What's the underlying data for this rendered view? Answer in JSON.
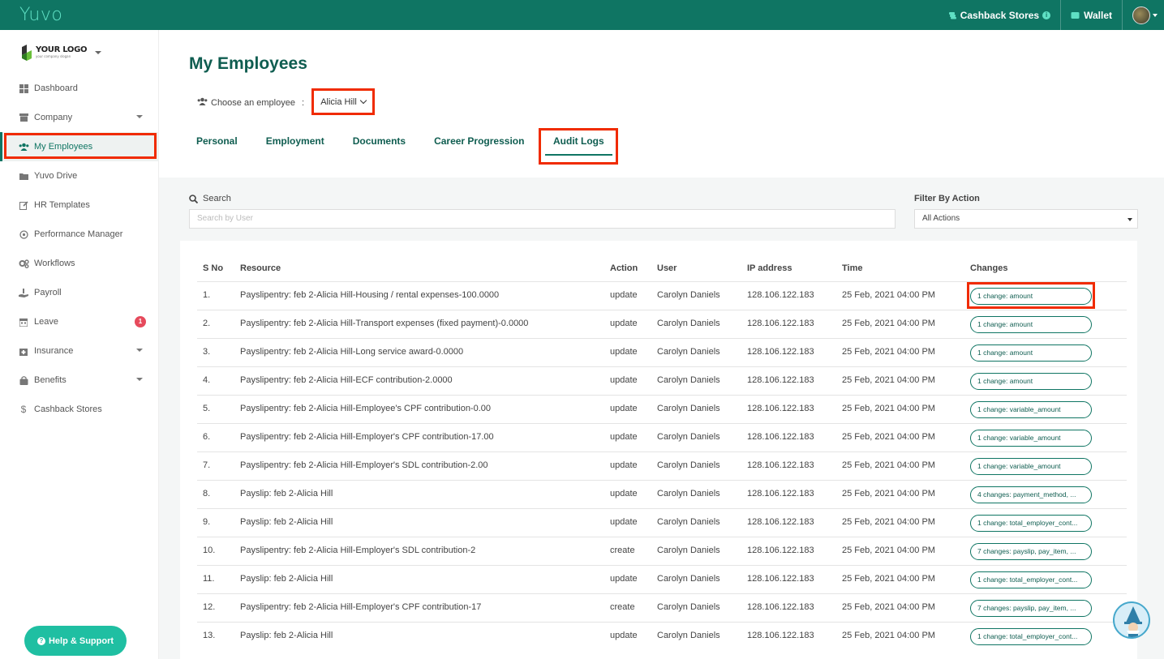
{
  "topbar": {
    "brand": "Yuvo",
    "cashback_label": "Cashback Stores",
    "wallet_label": "Wallet"
  },
  "sidebar": {
    "logo_title": "YOUR LOGO",
    "logo_slogan": "your company slogan",
    "items": [
      {
        "label": "Dashboard",
        "icon": "grid-icon"
      },
      {
        "label": "Company",
        "icon": "archive-icon"
      },
      {
        "label": "My Employees",
        "icon": "users-icon"
      },
      {
        "label": "Yuvo Drive",
        "icon": "folder-icon"
      },
      {
        "label": "HR Templates",
        "icon": "edit-icon"
      },
      {
        "label": "Performance Manager",
        "icon": "target-icon"
      },
      {
        "label": "Workflows",
        "icon": "cogs-icon"
      },
      {
        "label": "Payroll",
        "icon": "hand-coins-icon"
      },
      {
        "label": "Leave",
        "icon": "calendar-icon",
        "badge": "1"
      },
      {
        "label": "Insurance",
        "icon": "medkit-icon"
      },
      {
        "label": "Benefits",
        "icon": "bag-icon"
      },
      {
        "label": "Cashback Stores",
        "icon": "dollar-icon"
      }
    ],
    "help_label": "Help & Support"
  },
  "main": {
    "title": "My Employees",
    "choose_label": "Choose an employee",
    "separator": ":",
    "employee": "Alicia Hill",
    "tabs": [
      "Personal",
      "Employment",
      "Documents",
      "Career Progression",
      "Audit Logs"
    ],
    "search_label": "Search",
    "search_placeholder": "Search by User",
    "filter_label": "Filter By Action",
    "filter_value": "All Actions"
  },
  "table": {
    "headers": [
      "S No",
      "Resource",
      "Action",
      "User",
      "IP address",
      "Time",
      "Changes"
    ],
    "rows": [
      {
        "sno": "1.",
        "resource": "Payslipentry: feb 2-Alicia Hill-Housing / rental expenses-100.0000",
        "action": "update",
        "user": "Carolyn Daniels",
        "ip": "128.106.122.183",
        "time": "25 Feb, 2021 04:00 PM",
        "changes": "1 change: amount"
      },
      {
        "sno": "2.",
        "resource": "Payslipentry: feb 2-Alicia Hill-Transport expenses (fixed payment)-0.0000",
        "action": "update",
        "user": "Carolyn Daniels",
        "ip": "128.106.122.183",
        "time": "25 Feb, 2021 04:00 PM",
        "changes": "1 change: amount"
      },
      {
        "sno": "3.",
        "resource": "Payslipentry: feb 2-Alicia Hill-Long service award-0.0000",
        "action": "update",
        "user": "Carolyn Daniels",
        "ip": "128.106.122.183",
        "time": "25 Feb, 2021 04:00 PM",
        "changes": "1 change: amount"
      },
      {
        "sno": "4.",
        "resource": "Payslipentry: feb 2-Alicia Hill-ECF contribution-2.0000",
        "action": "update",
        "user": "Carolyn Daniels",
        "ip": "128.106.122.183",
        "time": "25 Feb, 2021 04:00 PM",
        "changes": "1 change: amount"
      },
      {
        "sno": "5.",
        "resource": "Payslipentry: feb 2-Alicia Hill-Employee's CPF contribution-0.00",
        "action": "update",
        "user": "Carolyn Daniels",
        "ip": "128.106.122.183",
        "time": "25 Feb, 2021 04:00 PM",
        "changes": "1 change: variable_amount"
      },
      {
        "sno": "6.",
        "resource": "Payslipentry: feb 2-Alicia Hill-Employer's CPF contribution-17.00",
        "action": "update",
        "user": "Carolyn Daniels",
        "ip": "128.106.122.183",
        "time": "25 Feb, 2021 04:00 PM",
        "changes": "1 change: variable_amount"
      },
      {
        "sno": "7.",
        "resource": "Payslipentry: feb 2-Alicia Hill-Employer's SDL contribution-2.00",
        "action": "update",
        "user": "Carolyn Daniels",
        "ip": "128.106.122.183",
        "time": "25 Feb, 2021 04:00 PM",
        "changes": "1 change: variable_amount"
      },
      {
        "sno": "8.",
        "resource": "Payslip: feb 2-Alicia Hill",
        "action": "update",
        "user": "Carolyn Daniels",
        "ip": "128.106.122.183",
        "time": "25 Feb, 2021 04:00 PM",
        "changes": "4 changes: payment_method, ..."
      },
      {
        "sno": "9.",
        "resource": "Payslip: feb 2-Alicia Hill",
        "action": "update",
        "user": "Carolyn Daniels",
        "ip": "128.106.122.183",
        "time": "25 Feb, 2021 04:00 PM",
        "changes": "1 change: total_employer_cont..."
      },
      {
        "sno": "10.",
        "resource": "Payslipentry: feb 2-Alicia Hill-Employer's SDL contribution-2",
        "action": "create",
        "user": "Carolyn Daniels",
        "ip": "128.106.122.183",
        "time": "25 Feb, 2021 04:00 PM",
        "changes": "7 changes: payslip, pay_item, ..."
      },
      {
        "sno": "11.",
        "resource": "Payslip: feb 2-Alicia Hill",
        "action": "update",
        "user": "Carolyn Daniels",
        "ip": "128.106.122.183",
        "time": "25 Feb, 2021 04:00 PM",
        "changes": "1 change: total_employer_cont..."
      },
      {
        "sno": "12.",
        "resource": "Payslipentry: feb 2-Alicia Hill-Employer's CPF contribution-17",
        "action": "create",
        "user": "Carolyn Daniels",
        "ip": "128.106.122.183",
        "time": "25 Feb, 2021 04:00 PM",
        "changes": "7 changes: payslip, pay_item, ..."
      },
      {
        "sno": "13.",
        "resource": "Payslip: feb 2-Alicia Hill",
        "action": "update",
        "user": "Carolyn Daniels",
        "ip": "128.106.122.183",
        "time": "25 Feb, 2021 04:00 PM",
        "changes": "1 change: total_employer_cont..."
      }
    ]
  }
}
